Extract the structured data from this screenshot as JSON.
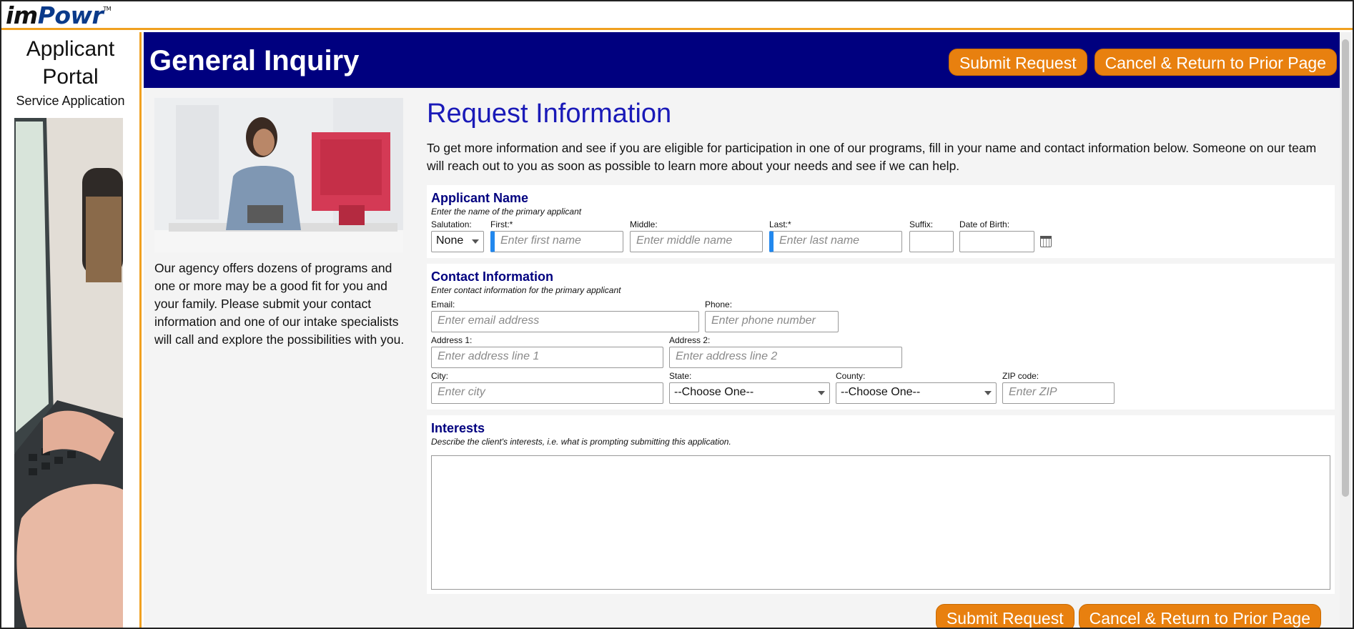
{
  "brand": {
    "logo_im": "im",
    "logo_powr": "Powr",
    "logo_tm": "TM"
  },
  "sidebar": {
    "title": "Applicant Portal",
    "subtitle": "Service Application"
  },
  "header": {
    "title": "General Inquiry",
    "submit_label": "Submit Request",
    "cancel_label": "Cancel & Return to Prior Page"
  },
  "promo": {
    "text": "Our agency offers dozens of programs and one or more may be a good fit for you and your family. Please submit your contact information and one of our intake specialists will call and explore the possibilities with you."
  },
  "main": {
    "heading": "Request Information",
    "intro": "To get more information and see if you are eligible for participation in one of our programs, fill in your name and contact information below. Someone on our team will reach out to you as soon as possible to learn more about your needs and see if we can help."
  },
  "applicant": {
    "title": "Applicant Name",
    "hint": "Enter the name of the primary applicant",
    "salutation_label": "Salutation:",
    "salutation_value": "None",
    "first_label": "First:*",
    "first_placeholder": "Enter first name",
    "middle_label": "Middle:",
    "middle_placeholder": "Enter middle name",
    "last_label": "Last:*",
    "last_placeholder": "Enter last name",
    "suffix_label": "Suffix:",
    "dob_label": "Date of Birth:"
  },
  "contact": {
    "title": "Contact Information",
    "hint": "Enter contact information for the primary applicant",
    "email_label": "Email:",
    "email_placeholder": "Enter email address",
    "phone_label": "Phone:",
    "phone_placeholder": "Enter phone number",
    "address1_label": "Address 1:",
    "address1_placeholder": "Enter address line 1",
    "address2_label": "Address 2:",
    "address2_placeholder": "Enter address line 2",
    "city_label": "City:",
    "city_placeholder": "Enter city",
    "state_label": "State:",
    "state_value": "--Choose One--",
    "county_label": "County:",
    "county_value": "--Choose One--",
    "zip_label": "ZIP code:",
    "zip_placeholder": "Enter ZIP"
  },
  "interests": {
    "title": "Interests",
    "hint": "Describe the client's interests, i.e. what is prompting submitting this application."
  },
  "footer": {
    "submit_label": "Submit Request",
    "cancel_label": "Cancel & Return to Prior Page"
  }
}
